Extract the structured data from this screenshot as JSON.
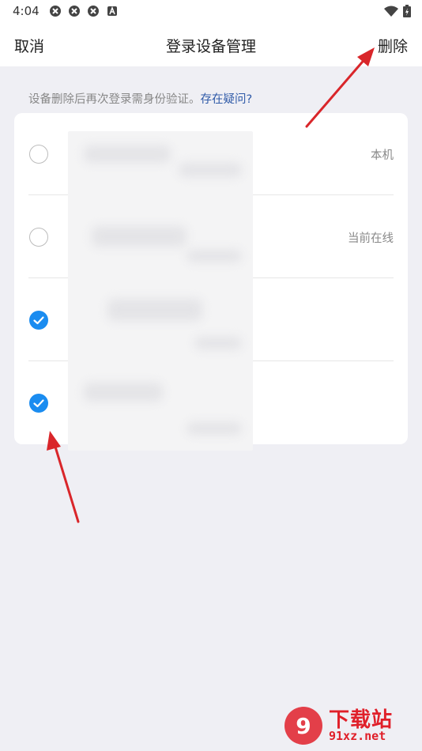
{
  "status_bar": {
    "time": "4:04",
    "icons": [
      "sync-icon",
      "sync-icon",
      "sync-icon",
      "a-box-icon"
    ],
    "right_icons": [
      "wifi-icon",
      "battery-icon"
    ]
  },
  "nav": {
    "cancel_label": "取消",
    "title": "登录设备管理",
    "delete_label": "删除"
  },
  "notice": {
    "text": "设备删除后再次登录需身份验证。",
    "link": "存在疑问?"
  },
  "devices": [
    {
      "checked": false,
      "tag": "本机"
    },
    {
      "checked": false,
      "tag": "当前在线"
    },
    {
      "checked": true,
      "tag": ""
    },
    {
      "checked": true,
      "tag": ""
    }
  ],
  "colors": {
    "accent": "#1a8cf0",
    "link": "#2f5aa8",
    "background": "#efeff4",
    "annotation_arrow": "#d9262a"
  },
  "watermark": {
    "logo_text": "9",
    "title": "下载站",
    "url": "91xz.net"
  }
}
